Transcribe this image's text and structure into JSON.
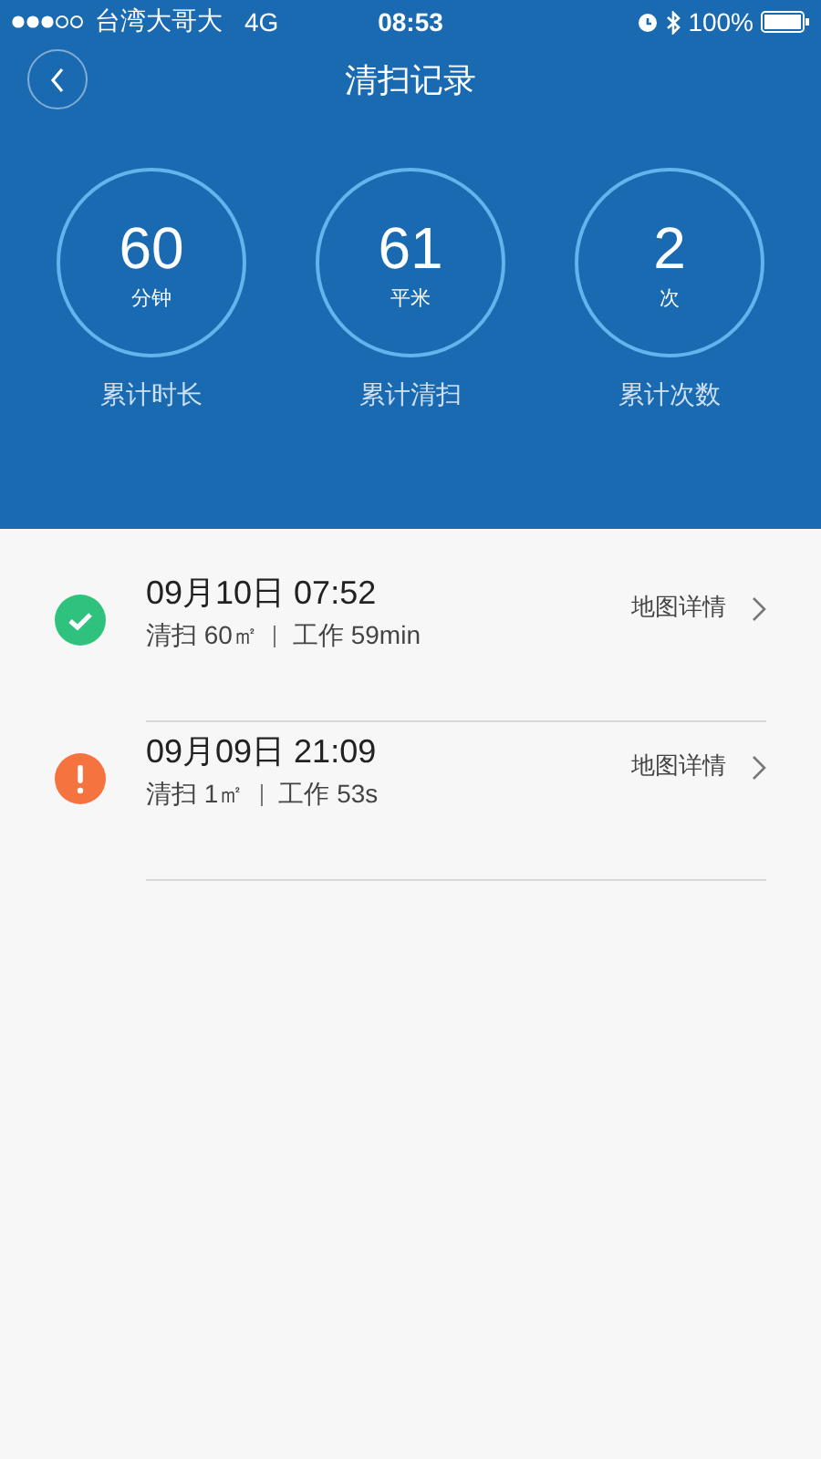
{
  "status_bar": {
    "carrier": "台湾大哥大",
    "network": "4G",
    "time": "08:53",
    "battery": "100%"
  },
  "nav": {
    "title": "清扫记录"
  },
  "stats": [
    {
      "value": "60",
      "unit": "分钟",
      "label": "累计时长"
    },
    {
      "value": "61",
      "unit": "平米",
      "label": "累计清扫"
    },
    {
      "value": "2",
      "unit": "次",
      "label": "累计次数"
    }
  ],
  "records": [
    {
      "kind": "success",
      "date": "09月10日 07:52",
      "area": "清扫 60㎡",
      "work": "工作 59min",
      "link": "地图详情"
    },
    {
      "kind": "error",
      "date": "09月09日 21:09",
      "area": "清扫 1㎡",
      "work": "工作 53s",
      "link": "地图详情"
    }
  ]
}
